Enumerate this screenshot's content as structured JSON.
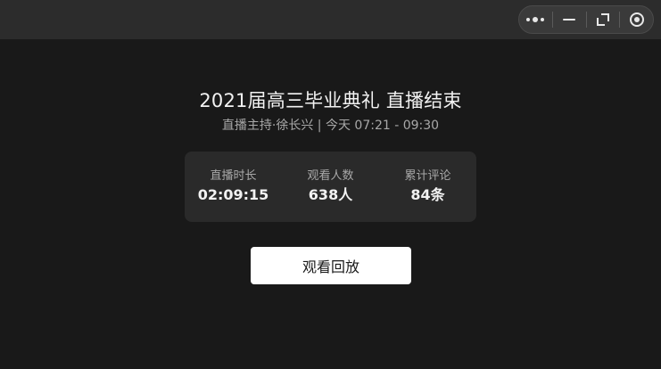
{
  "topbar": {
    "capsule": {
      "more_icon": "more-dots-icon",
      "minimize_icon": "minimize-icon",
      "float_icon": "float-window-icon",
      "close_icon": "close-target-icon"
    }
  },
  "live": {
    "title": "2021届高三毕业典礼 直播结束",
    "subtitle": "直播主持·徐长兴 | 今天 07:21 - 09:30",
    "stats": [
      {
        "label": "直播时长",
        "value": "02:09:15"
      },
      {
        "label": "观看人数",
        "value": "638人"
      },
      {
        "label": "累计评论",
        "value": "84条"
      }
    ],
    "replay_label": "观看回放"
  },
  "colors": {
    "background": "#191919",
    "topbar": "#2c2c2c",
    "stats_card": "#2a2a2a",
    "button": "#ffffff"
  }
}
